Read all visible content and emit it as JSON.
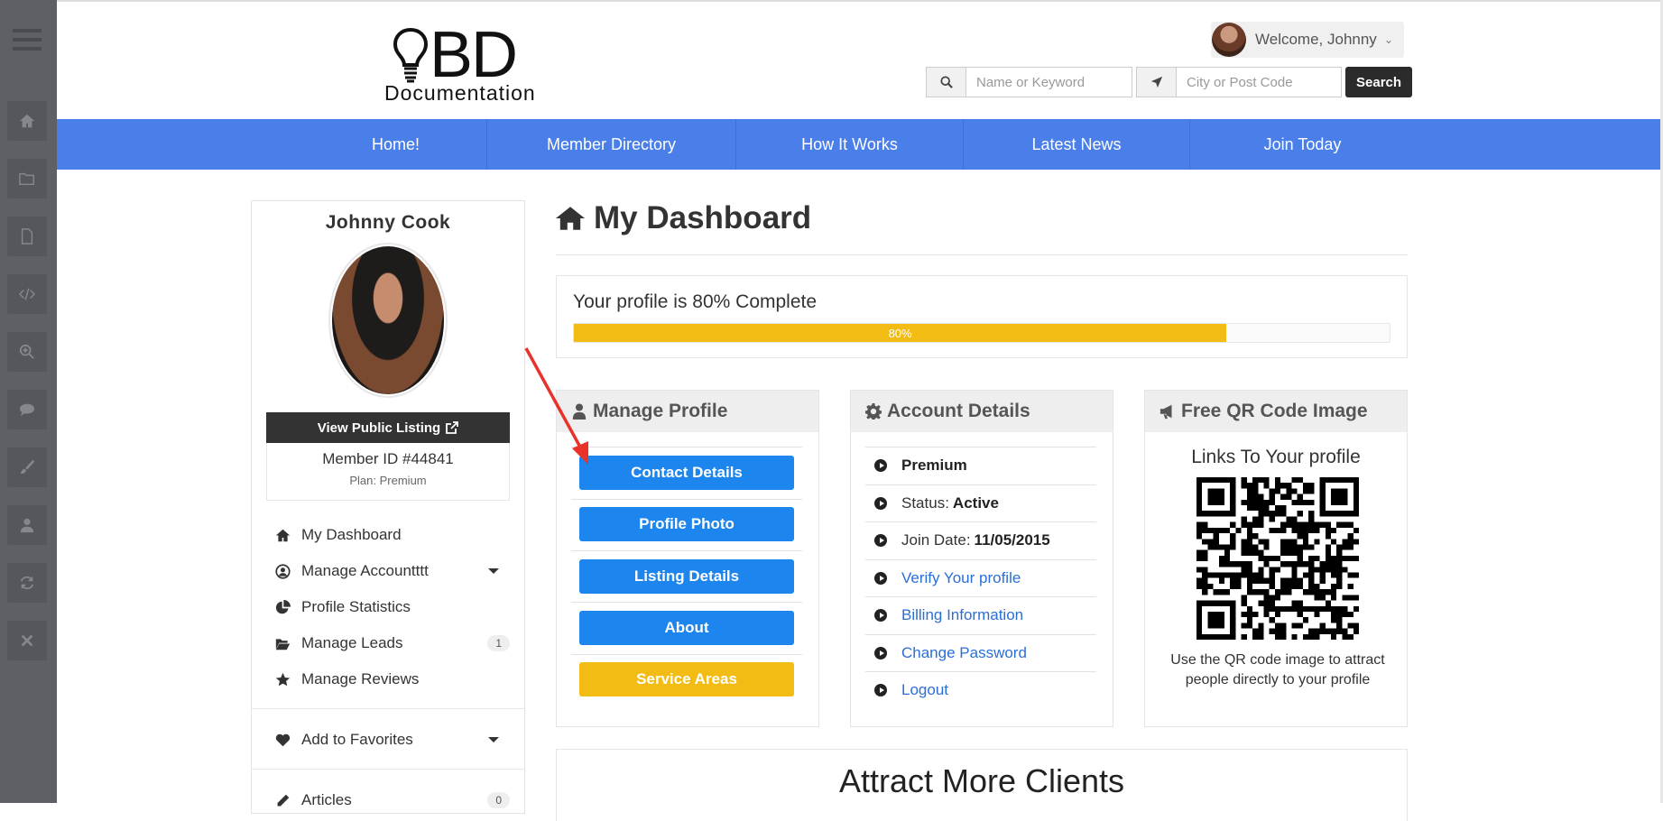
{
  "header": {
    "logo_mark": "BD",
    "logo_text": "Documentation",
    "welcome": "Welcome, Johnny",
    "search_keyword_placeholder": "Name or Keyword",
    "search_location_placeholder": "City or Post Code",
    "search_button": "Search"
  },
  "nav": [
    {
      "label": "Home!"
    },
    {
      "label": "Member Directory"
    },
    {
      "label": "How It Works"
    },
    {
      "label": "Latest News"
    },
    {
      "label": "Join Today"
    }
  ],
  "left_toolbar_icons": [
    "menu-icon",
    "home-icon",
    "folder-icon",
    "file-icon",
    "code-icon",
    "zoom-icon",
    "chat-icon",
    "brush-icon",
    "user-icon",
    "refresh-icon",
    "close-icon"
  ],
  "profile": {
    "name": "Johnny Cook",
    "view_public": "View Public Listing",
    "member_id": "Member ID #44841",
    "plan": "Plan: Premium"
  },
  "sidebar_menu": [
    {
      "label": "My Dashboard",
      "icon": "home-icon"
    },
    {
      "label": "Manage Accountttt",
      "icon": "user-circle-icon",
      "dropdown": true
    },
    {
      "label": "Profile Statistics",
      "icon": "pie-chart-icon"
    },
    {
      "label": "Manage Leads",
      "icon": "folder-open-icon",
      "badge": "1"
    },
    {
      "label": "Manage Reviews",
      "icon": "star-icon"
    }
  ],
  "sidebar_menu2": [
    {
      "label": "Add to Favorites",
      "icon": "heart-icon",
      "dropdown": true
    }
  ],
  "sidebar_menu3": [
    {
      "label": "Articles",
      "icon": "pencil-icon",
      "badge": "0"
    }
  ],
  "dashboard": {
    "title": "My Dashboard",
    "profile_complete_text": "Your profile is 80% Complete",
    "progress_percent": 80,
    "progress_label": "80%"
  },
  "manage_profile": {
    "title": "Manage Profile",
    "buttons": [
      {
        "label": "Contact Details",
        "color": "#1c86ee"
      },
      {
        "label": "Profile Photo",
        "color": "#1c86ee"
      },
      {
        "label": "Listing Details",
        "color": "#1c86ee"
      },
      {
        "label": "About",
        "color": "#1c86ee"
      },
      {
        "label": "Service Areas",
        "color": "#f2bc14"
      }
    ]
  },
  "account_details": {
    "title": "Account Details",
    "items": [
      {
        "label": "",
        "value": "Premium",
        "link": false
      },
      {
        "label": "Status:",
        "value": "Active",
        "link": false
      },
      {
        "label": "Join Date:",
        "value": "11/05/2015",
        "link": false
      },
      {
        "label": "Verify Your profile",
        "value": "",
        "link": true
      },
      {
        "label": "Billing Information",
        "value": "",
        "link": true
      },
      {
        "label": "Change Password",
        "value": "",
        "link": true
      },
      {
        "label": "Logout",
        "value": "",
        "link": true
      }
    ]
  },
  "qr": {
    "title": "Free QR Code Image",
    "subtitle": "Links To Your profile",
    "note": "Use the QR code image to attract people directly to your profile"
  },
  "attract": {
    "title": "Attract More Clients"
  },
  "colors": {
    "nav": "#4a7fea",
    "primary_button": "#1c86ee",
    "warning": "#f2bc14",
    "annotation_arrow": "#e8322a"
  }
}
